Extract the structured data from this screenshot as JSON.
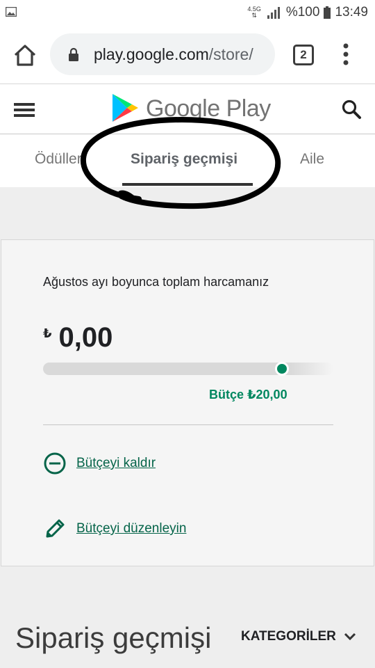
{
  "status_bar": {
    "network": "4.5G",
    "battery_percent": "%100",
    "time": "13:49",
    "icons": [
      "gallery-icon",
      "signal-icon",
      "battery-icon"
    ]
  },
  "browser": {
    "url_host": "play.google.com",
    "url_path": "/store/",
    "tab_count": "2",
    "icons": [
      "home-icon",
      "lock-icon",
      "more-vert-icon"
    ]
  },
  "header": {
    "logo_text": "Google Play",
    "icons": [
      "menu-icon",
      "google-play-logo-icon",
      "search-icon"
    ]
  },
  "tabs": [
    {
      "label": "Ödüller"
    },
    {
      "label": "Sipariş geçmişi",
      "selected": true
    },
    {
      "label": "Aile"
    }
  ],
  "budget": {
    "title": "Ağustos ayı boyunca toplam harcamanız",
    "currency_symbol": "₺",
    "amount": "0,00",
    "budget_label": "Bütçe ₺20,00",
    "spent_fraction": 0,
    "remove_link": "Bütçeyi kaldır",
    "edit_link": "Bütçeyi düzenleyin",
    "accent_color": "#01875f",
    "link_color": "#056449"
  },
  "section": {
    "title": "Sipariş geçmişi",
    "categories_label": "KATEGORİLER"
  }
}
